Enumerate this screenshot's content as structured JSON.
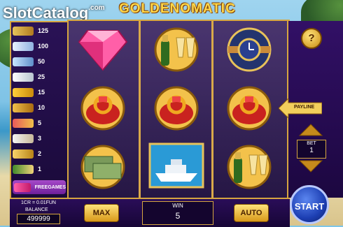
{
  "header": {
    "title": "GOLDENOMATIC",
    "watermark": "SlotCatalog",
    "watermark_suffix": ".com"
  },
  "paytable": {
    "rows": [
      {
        "value": "125",
        "symbol": "watch-icon"
      },
      {
        "value": "100",
        "symbol": "yacht-icon"
      },
      {
        "value": "50",
        "symbol": "car-icon"
      },
      {
        "value": "25",
        "symbol": "jet-icon"
      },
      {
        "value": "15",
        "symbol": "coins-icon"
      },
      {
        "value": "10",
        "symbol": "ring-icon"
      },
      {
        "value": "5",
        "symbol": "gold-ring-icon"
      },
      {
        "value": "3",
        "symbol": "pearls-icon"
      },
      {
        "value": "2",
        "symbol": "chain-icon"
      },
      {
        "value": "1",
        "symbol": "champagne-icon"
      }
    ],
    "free_label": "FREEGAMES"
  },
  "reels": [
    [
      "diamond-icon",
      "ring-icon",
      "money-icon"
    ],
    [
      "champagne-icon",
      "ring-icon",
      "yacht-icon"
    ],
    [
      "watch-icon",
      "ring-icon",
      "champagne-icon"
    ]
  ],
  "controls": {
    "help_label": "?",
    "payline_label": "PAYLINE",
    "bet_label": "BET",
    "bet_value": "1",
    "start_label": "START",
    "max_label": "MAX",
    "auto_label": "AUTO",
    "win_label": "WIN",
    "win_value": "5",
    "credit_info": "1CR = 0.01FUN",
    "balance_label": "BALANCE",
    "balance_value": "499999"
  },
  "colors": {
    "frame": "#d6a640",
    "panel": "#2a0d58",
    "start": "#1d3fb3"
  }
}
